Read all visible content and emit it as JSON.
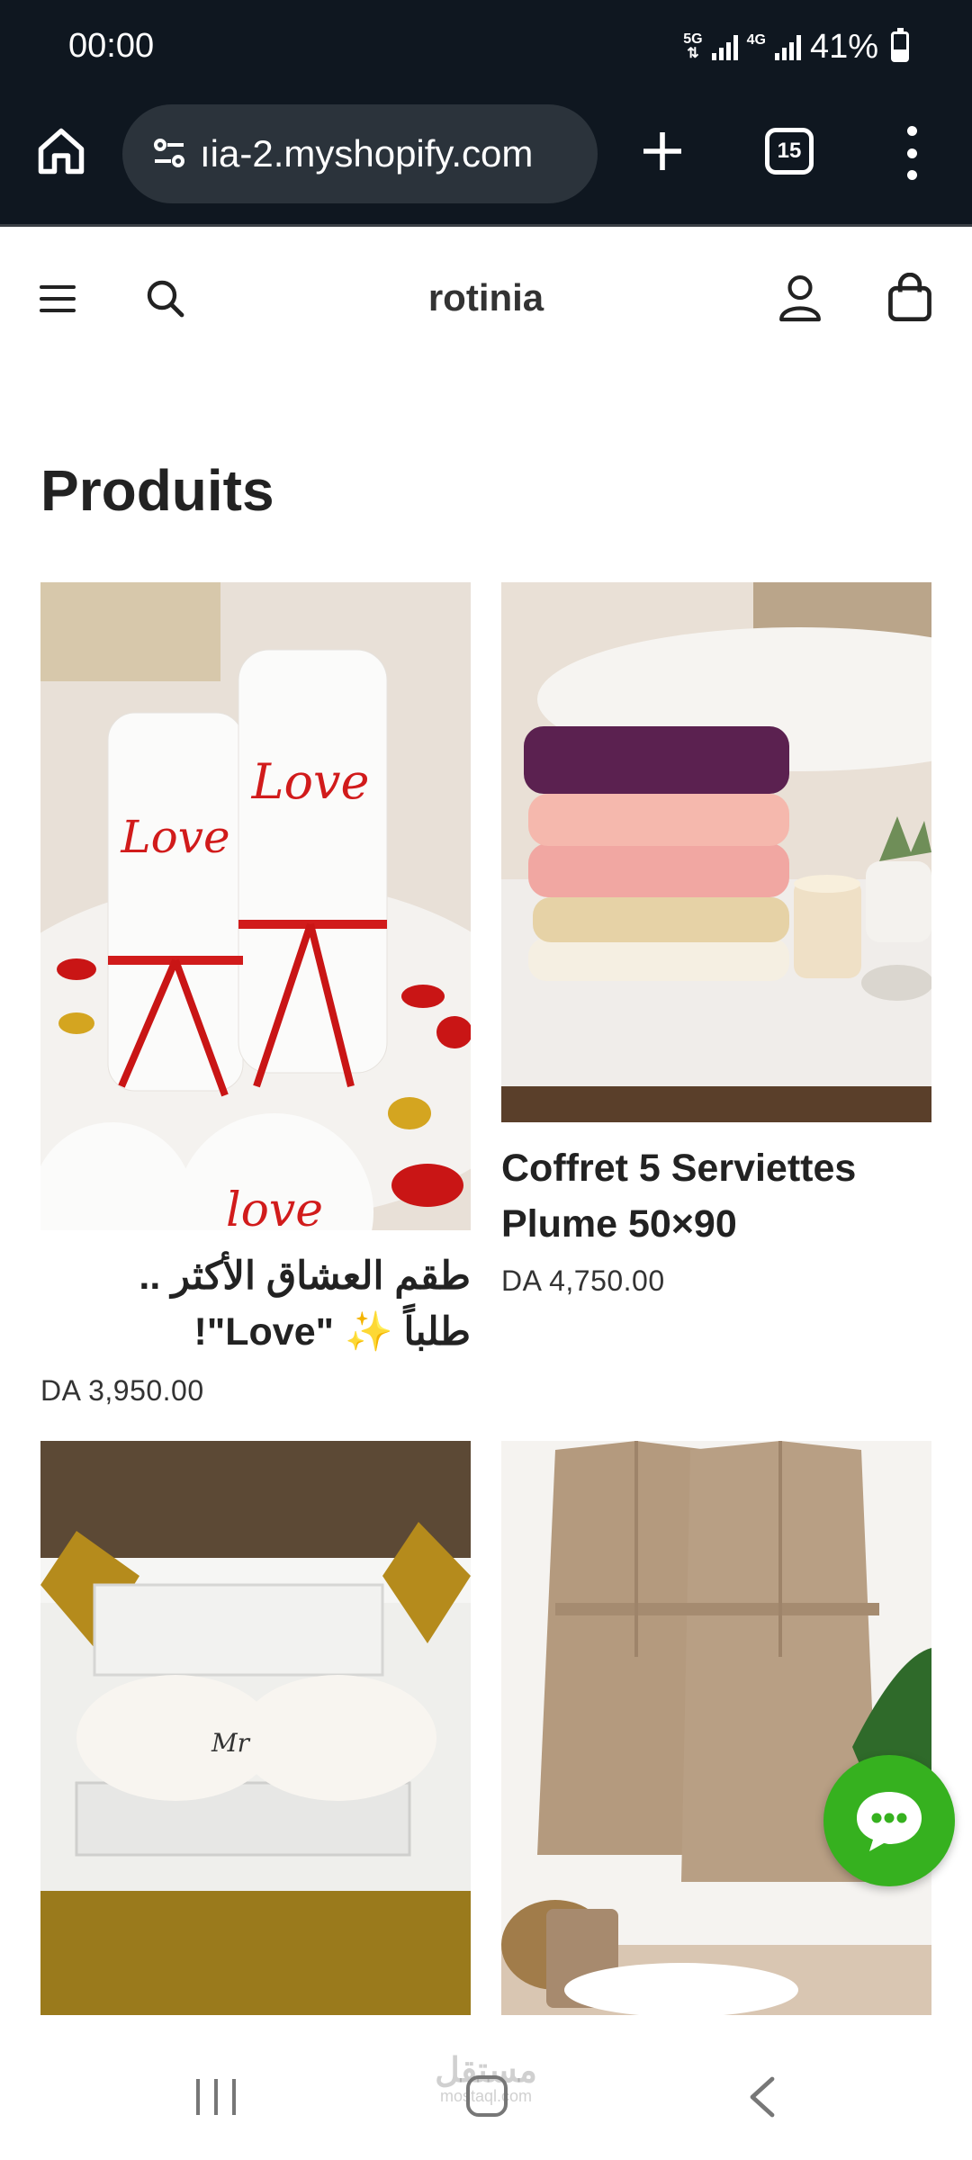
{
  "status_bar": {
    "time": "00:00",
    "network_1": "5G",
    "network_2": "4G",
    "battery_percent": "41%",
    "battery_level": 0.41
  },
  "browser": {
    "url": "ıia-2.myshopify.com",
    "tab_count": "15",
    "icons": [
      "home-icon",
      "tune-icon",
      "plus-icon",
      "tabs-icon",
      "more-vert-icon"
    ]
  },
  "store": {
    "logo": "rotinia",
    "icons": [
      "menu-icon",
      "search-icon",
      "account-icon",
      "cart-icon"
    ]
  },
  "page": {
    "title": "Produits"
  },
  "products": [
    {
      "name": "طقم العشاق الأكثر طلباً ✨ \"Love\"!",
      "name_line1": "طقم العشاق الأكثر ..",
      "name_line2": "طلباً ✨ \"Love\"!",
      "price": "DA 3,950.00"
    },
    {
      "name_line1": "Coffret 5 Serviettes",
      "name_line2": "Plume 50×90",
      "price": "DA 4,750.00"
    },
    {},
    {}
  ],
  "chat": {
    "icon": "chat-bubble-icon",
    "color": "#36b11f"
  },
  "watermark": {
    "text": "مستقل",
    "subtext": "mostaql.com"
  }
}
